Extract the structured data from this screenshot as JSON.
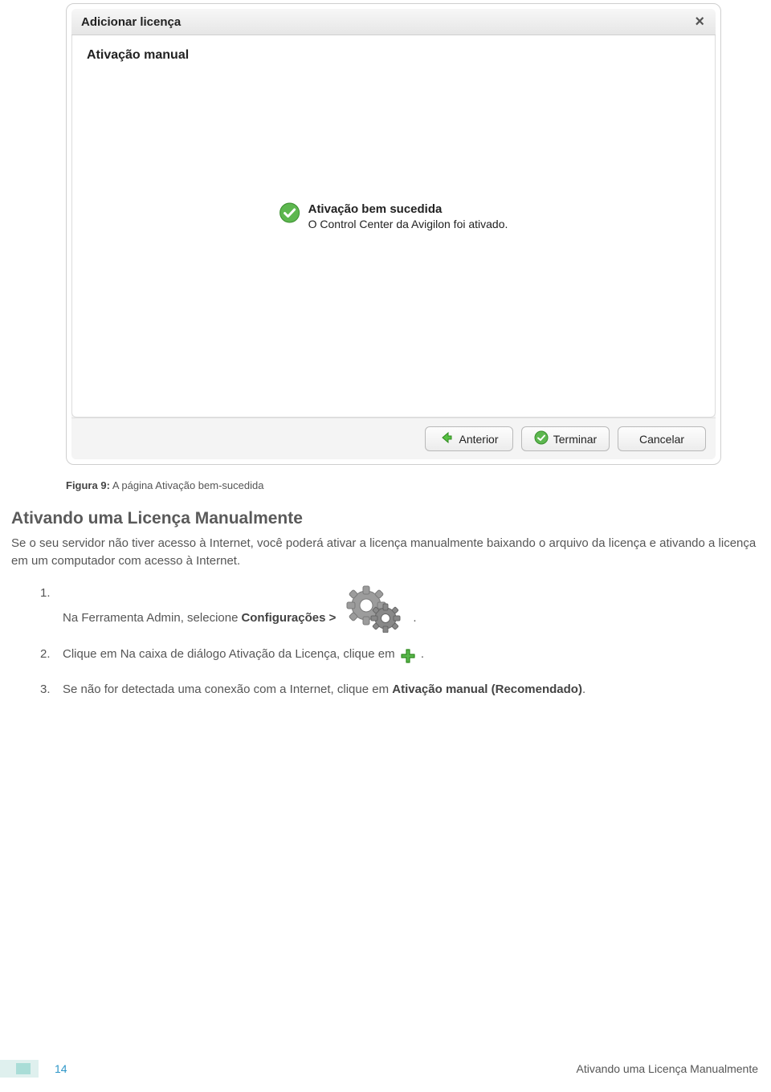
{
  "dialog": {
    "title": "Adicionar licença",
    "subtitle": "Ativação manual",
    "success_title": "Ativação bem sucedida",
    "success_message": "O Control Center da Avigilon foi ativado.",
    "buttons": {
      "back": "Anterior",
      "finish": "Terminar",
      "cancel": "Cancelar"
    }
  },
  "caption": {
    "label": "Figura 9:",
    "text": "A página Ativação bem-sucedida"
  },
  "section_title": "Ativando uma Licença Manualmente",
  "lead": "Se o seu servidor não tiver acesso à Internet, você poderá ativar a licença manualmente baixando o arquivo da licença e ativando a licença em um computador com acesso à Internet.",
  "steps": {
    "s1a": "Na Ferramenta Admin, selecione ",
    "s1b": "Configurações >",
    "s1c": ".",
    "s2a": "Clique em  Na caixa de diálogo Ativação da Licença, clique em ",
    "s2b": ".",
    "s3a": "Se não for detectada uma conexão com a Internet, clique em ",
    "s3b": "Ativação manual (Recomendado)",
    "s3c": "."
  },
  "footer": {
    "page_number": "14",
    "section": "Ativando uma Licença Manualmente"
  }
}
